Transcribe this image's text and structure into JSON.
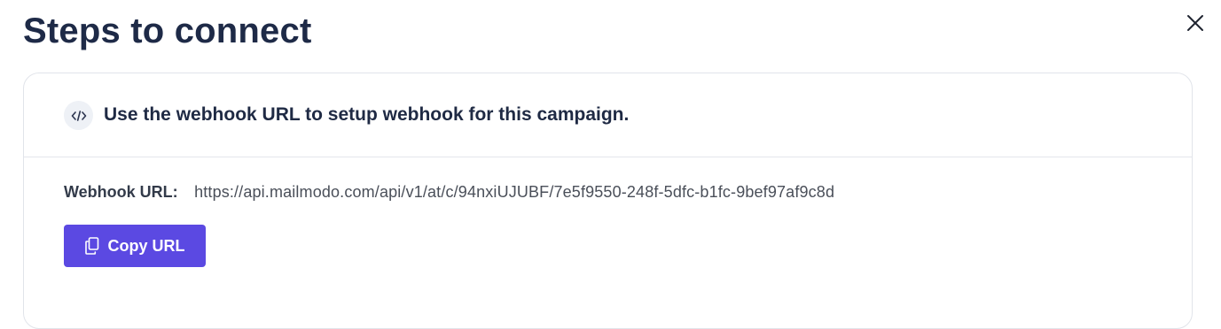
{
  "dialog": {
    "title": "Steps to connect"
  },
  "card": {
    "heading": "Use the webhook URL to setup webhook for this campaign.",
    "url_label": "Webhook URL:",
    "url_value": "https://api.mailmodo.com/api/v1/at/c/94nxiUJUBF/7e5f9550-248f-5dfc-b1fc-9bef97af9c8d",
    "copy_button_label": "Copy URL"
  },
  "icons": {
    "close": "close-icon",
    "code": "code-icon",
    "copy": "copy-icon"
  },
  "colors": {
    "primary": "#5b49e2",
    "title": "#1e2a47",
    "border": "#e1e4ea"
  }
}
